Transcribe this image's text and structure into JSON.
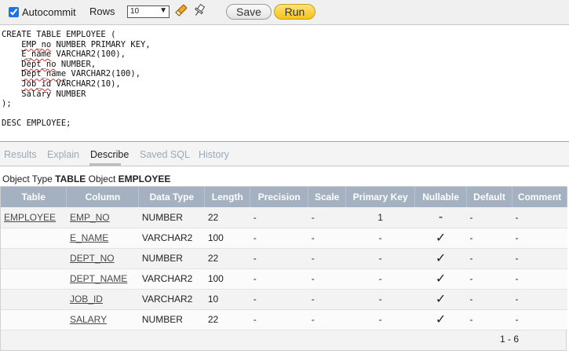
{
  "toolbar": {
    "autocommit_label": "Autocommit",
    "autocommit_checked": true,
    "rows_label": "Rows",
    "rows_value": "10",
    "save_label": "Save",
    "run_label": "Run",
    "icons": [
      "eraser-icon",
      "pin-icon"
    ]
  },
  "editor": {
    "lines": [
      "CREATE TABLE EMPLOYEE (",
      "    EMP_no NUMBER PRIMARY KEY,",
      "    E_name VARCHAR2(100),",
      "    Dept_no NUMBER,",
      "    Dept_name VARCHAR2(100),",
      "    Job_id VARCHAR2(10),",
      "    Salary NUMBER",
      ");",
      "",
      "DESC EMPLOYEE;"
    ]
  },
  "tabs": [
    "Results",
    "Explain",
    "Describe",
    "Saved SQL",
    "History"
  ],
  "active_tab": "Describe",
  "object": {
    "type_label": "Object Type",
    "type_value": "TABLE",
    "object_label": "Object",
    "object_value": "EMPLOYEE"
  },
  "table": {
    "headers": [
      "Table",
      "Column",
      "Data Type",
      "Length",
      "Precision",
      "Scale",
      "Primary Key",
      "Nullable",
      "Default",
      "Comment"
    ],
    "rows": [
      {
        "table": "EMPLOYEE",
        "column": "EMP_NO",
        "data_type": "NUMBER",
        "length": "22",
        "precision": "-",
        "scale": "-",
        "primary_key": "1",
        "nullable": "-",
        "default": "-",
        "comment": "-"
      },
      {
        "table": "",
        "column": "E_NAME",
        "data_type": "VARCHAR2",
        "length": "100",
        "precision": "-",
        "scale": "-",
        "primary_key": "-",
        "nullable": "✓",
        "default": "-",
        "comment": "-"
      },
      {
        "table": "",
        "column": "DEPT_NO",
        "data_type": "NUMBER",
        "length": "22",
        "precision": "-",
        "scale": "-",
        "primary_key": "-",
        "nullable": "✓",
        "default": "-",
        "comment": "-"
      },
      {
        "table": "",
        "column": "DEPT_NAME",
        "data_type": "VARCHAR2",
        "length": "100",
        "precision": "-",
        "scale": "-",
        "primary_key": "-",
        "nullable": "✓",
        "default": "-",
        "comment": "-"
      },
      {
        "table": "",
        "column": "JOB_ID",
        "data_type": "VARCHAR2",
        "length": "10",
        "precision": "-",
        "scale": "-",
        "primary_key": "-",
        "nullable": "✓",
        "default": "-",
        "comment": "-"
      },
      {
        "table": "",
        "column": "SALARY",
        "data_type": "NUMBER",
        "length": "22",
        "precision": "-",
        "scale": "-",
        "primary_key": "-",
        "nullable": "✓",
        "default": "-",
        "comment": "-"
      }
    ],
    "pager": "1 - 6"
  }
}
